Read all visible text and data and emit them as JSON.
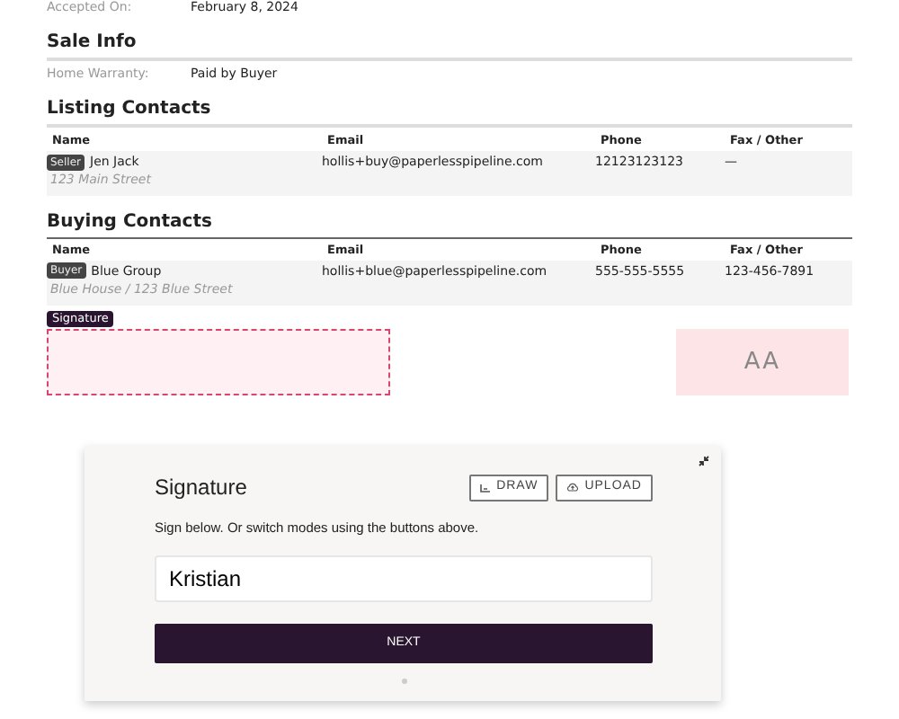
{
  "accepted": {
    "label": "Accepted On:",
    "value": "February 8, 2024"
  },
  "sale_info": {
    "title": "Sale Info",
    "fields": [
      {
        "label": "Home Warranty:",
        "value": "Paid by Buyer"
      }
    ]
  },
  "listing_contacts": {
    "title": "Listing Contacts",
    "columns": [
      "Name",
      "Email",
      "Phone",
      "Fax / Other"
    ],
    "rows": [
      {
        "role": "Seller",
        "name": "Jen Jack",
        "address": "123 Main Street",
        "email": "hollis+buy@paperlesspipeline.com",
        "phone": "12123123123",
        "fax": "—"
      }
    ]
  },
  "buying_contacts": {
    "title": "Buying Contacts",
    "columns": [
      "Name",
      "Email",
      "Phone",
      "Fax / Other"
    ],
    "rows": [
      {
        "role": "Buyer",
        "name": "Blue Group",
        "address": "Blue House / 123 Blue Street",
        "email": "hollis+blue@paperlesspipeline.com",
        "phone": "555-555-5555",
        "fax": "123-456-7891"
      }
    ]
  },
  "signature_tag": "Signature",
  "initials_box": {
    "text": "AA"
  },
  "signature_dialog": {
    "title": "Signature",
    "modes": [
      {
        "label": "DRAW",
        "kind": "draw"
      },
      {
        "label": "UPLOAD",
        "kind": "upload"
      }
    ],
    "hint": "Sign below. Or switch modes using the buttons above.",
    "value": "Kristian",
    "submit": "NEXT"
  }
}
